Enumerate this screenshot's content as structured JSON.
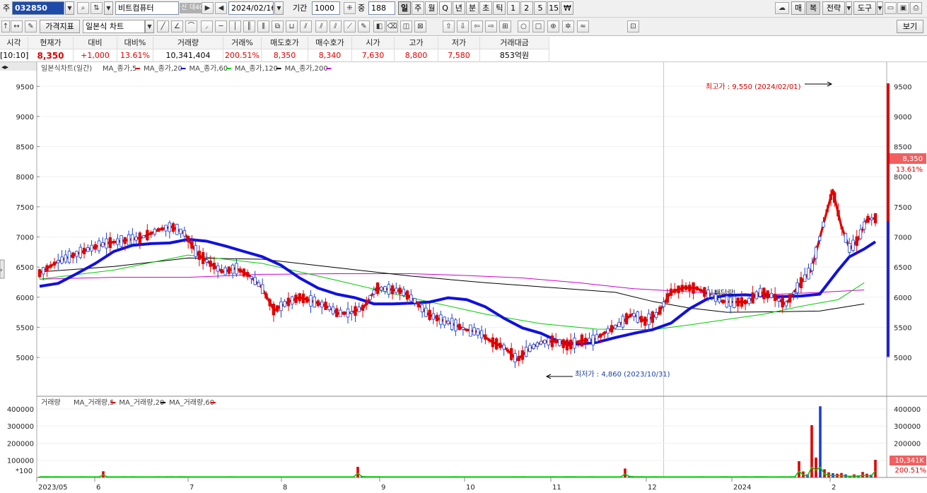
{
  "toolbar": {
    "market_prefix": "주",
    "stock_code": "032850",
    "stock_name": "비트컴퓨터",
    "credit_tag": "신",
    "margin_tag": "대40",
    "date": "2024/02/16",
    "period_label": "기간",
    "period_value": "1000",
    "count_label": "중",
    "count_value": "188",
    "periods": [
      "일",
      "주",
      "월",
      "Q",
      "년",
      "분",
      "초",
      "틱",
      "1",
      "2",
      "5",
      "15",
      "₩"
    ],
    "active_period": "일",
    "right_tabs": [
      "매",
      "복",
      "전략",
      "도구"
    ],
    "second_row": {
      "price_indicator_label": "가격지표",
      "chart_type_value": "일본식 차트",
      "view_label": "보기"
    }
  },
  "quote": {
    "headers": [
      "시각",
      "현재가",
      "대비",
      "대비%",
      "거래량",
      "거래%",
      "매도호가",
      "매수호가",
      "시가",
      "고가",
      "저가",
      "거래대금"
    ],
    "values": [
      "[10:10]",
      "8,350",
      "+1,000",
      "13.61%",
      "10,341,404",
      "200.51%",
      "8,350",
      "8,340",
      "7,630",
      "8,800",
      "7,580",
      "853억원"
    ]
  },
  "chart_data": [
    {
      "type": "candlestick",
      "legend_title": "일본식차트(일간)",
      "series": [
        {
          "name": "MA_종가,5",
          "color": "#e00000"
        },
        {
          "name": "MA_종가,20",
          "color": "#0000ee"
        },
        {
          "name": "MA_종가,60",
          "color": "#00cc00"
        },
        {
          "name": "MA_종가,120",
          "color": "#000000"
        },
        {
          "name": "MA_종가,200",
          "color": "#cc00cc"
        }
      ],
      "y_ticks": [
        9500,
        9000,
        8500,
        8000,
        7500,
        7000,
        6500,
        6000,
        5500,
        5000
      ],
      "ylim": [
        4700,
        9800
      ],
      "x_labels": [
        "2023/05",
        "6",
        "7",
        "8",
        "9",
        "10",
        "11",
        "12",
        "2024",
        "2"
      ],
      "current_price_label": "8,350",
      "current_change_label": "13.61%",
      "annotations": {
        "high": "최고가 : 9,550 (2024/02/01)",
        "low": "최저가 : 4,860 (2023/10/31)",
        "dividend": "배당락"
      },
      "ma20_path": [
        [
          0,
          6180
        ],
        [
          5,
          6230
        ],
        [
          10,
          6390
        ],
        [
          15,
          6560
        ],
        [
          20,
          6760
        ],
        [
          25,
          6860
        ],
        [
          30,
          6890
        ],
        [
          35,
          6900
        ],
        [
          40,
          6960
        ],
        [
          45,
          6930
        ],
        [
          50,
          6850
        ],
        [
          55,
          6760
        ],
        [
          60,
          6670
        ],
        [
          65,
          6530
        ],
        [
          70,
          6320
        ],
        [
          75,
          6150
        ],
        [
          80,
          6050
        ],
        [
          85,
          5990
        ],
        [
          90,
          5890
        ],
        [
          95,
          5890
        ],
        [
          100,
          5900
        ],
        [
          105,
          5920
        ],
        [
          110,
          5990
        ],
        [
          115,
          5960
        ],
        [
          120,
          5840
        ],
        [
          125,
          5650
        ],
        [
          130,
          5490
        ],
        [
          135,
          5400
        ],
        [
          140,
          5260
        ],
        [
          145,
          5220
        ],
        [
          150,
          5250
        ],
        [
          155,
          5330
        ],
        [
          160,
          5400
        ],
        [
          165,
          5460
        ],
        [
          170,
          5570
        ],
        [
          175,
          5810
        ],
        [
          180,
          5980
        ],
        [
          185,
          6030
        ],
        [
          190,
          6040
        ],
        [
          195,
          6020
        ],
        [
          200,
          6010
        ],
        [
          205,
          6020
        ],
        [
          210,
          6050
        ],
        [
          215,
          6450
        ],
        [
          218,
          6670
        ],
        [
          222,
          6800
        ],
        [
          225,
          6920
        ]
      ],
      "ma5_path": [
        [
          0,
          6400
        ],
        [
          4,
          6580
        ],
        [
          8,
          6700
        ],
        [
          12,
          6810
        ],
        [
          16,
          6900
        ],
        [
          20,
          6940
        ],
        [
          24,
          6990
        ],
        [
          28,
          7120
        ],
        [
          31,
          7170
        ],
        [
          34,
          7060
        ],
        [
          37,
          6720
        ],
        [
          40,
          6560
        ],
        [
          43,
          6420
        ],
        [
          46,
          6480
        ],
        [
          49,
          6370
        ],
        [
          52,
          6170
        ],
        [
          55,
          5780
        ],
        [
          58,
          5910
        ],
        [
          61,
          6000
        ],
        [
          64,
          5930
        ],
        [
          67,
          5860
        ],
        [
          70,
          5730
        ],
        [
          73,
          5740
        ],
        [
          76,
          5830
        ],
        [
          79,
          6150
        ],
        [
          82,
          6130
        ],
        [
          85,
          6100
        ],
        [
          88,
          5940
        ],
        [
          91,
          5720
        ],
        [
          94,
          5630
        ],
        [
          97,
          5550
        ],
        [
          100,
          5460
        ],
        [
          103,
          5420
        ],
        [
          106,
          5260
        ],
        [
          109,
          5170
        ],
        [
          112,
          4960
        ],
        [
          115,
          5150
        ],
        [
          118,
          5260
        ],
        [
          121,
          5270
        ],
        [
          124,
          5200
        ],
        [
          127,
          5280
        ],
        [
          130,
          5290
        ],
        [
          133,
          5430
        ],
        [
          136,
          5550
        ],
        [
          139,
          5720
        ],
        [
          142,
          5600
        ],
        [
          145,
          5720
        ],
        [
          148,
          6080
        ],
        [
          151,
          6160
        ],
        [
          154,
          6150
        ],
        [
          157,
          6050
        ],
        [
          160,
          5930
        ],
        [
          163,
          5920
        ],
        [
          166,
          5920
        ],
        [
          169,
          6080
        ],
        [
          172,
          6020
        ],
        [
          175,
          5880
        ],
        [
          178,
          6190
        ],
        [
          181,
          6450
        ],
        [
          184,
          7260
        ],
        [
          186,
          7780
        ],
        [
          188,
          7180
        ],
        [
          190,
          6800
        ],
        [
          192,
          6960
        ],
        [
          194,
          7290
        ],
        [
          196,
          7310
        ]
      ],
      "ma60_path": [
        [
          0,
          6300
        ],
        [
          20,
          6450
        ],
        [
          40,
          6700
        ],
        [
          60,
          6560
        ],
        [
          80,
          6280
        ],
        [
          100,
          5990
        ],
        [
          120,
          5720
        ],
        [
          135,
          5560
        ],
        [
          150,
          5470
        ],
        [
          165,
          5460
        ],
        [
          175,
          5540
        ],
        [
          185,
          5630
        ],
        [
          195,
          5720
        ],
        [
          205,
          5850
        ],
        [
          215,
          5960
        ],
        [
          222,
          6240
        ]
      ],
      "ma120_path": [
        [
          0,
          6420
        ],
        [
          20,
          6510
        ],
        [
          40,
          6650
        ],
        [
          60,
          6630
        ],
        [
          80,
          6490
        ],
        [
          100,
          6350
        ],
        [
          120,
          6240
        ],
        [
          140,
          6150
        ],
        [
          155,
          6080
        ],
        [
          165,
          5930
        ],
        [
          175,
          5820
        ],
        [
          185,
          5750
        ],
        [
          200,
          5760
        ],
        [
          210,
          5770
        ],
        [
          222,
          5890
        ]
      ],
      "ma200_path": [
        [
          0,
          6300
        ],
        [
          20,
          6330
        ],
        [
          40,
          6330
        ],
        [
          60,
          6380
        ],
        [
          80,
          6390
        ],
        [
          100,
          6390
        ],
        [
          115,
          6360
        ],
        [
          130,
          6320
        ],
        [
          145,
          6240
        ],
        [
          160,
          6140
        ],
        [
          175,
          6090
        ],
        [
          185,
          6050
        ],
        [
          195,
          6040
        ],
        [
          210,
          6080
        ],
        [
          222,
          6120
        ]
      ]
    },
    {
      "type": "bar",
      "legend_title": "거래량",
      "series": [
        {
          "name": "MA_거래량,5",
          "color": "#e00000"
        },
        {
          "name": "MA_거래량,20",
          "color": "#000000"
        },
        {
          "name": "MA_거래량,60",
          "color": "#e00000"
        }
      ],
      "y_ticks": [
        400000,
        300000,
        200000,
        100000
      ],
      "ylim": [
        0,
        420000
      ],
      "unit_label": "*100",
      "current_volume_label": "10,341K",
      "current_ratio_label": "200.51%",
      "values": [
        4000,
        3000,
        3500,
        2500,
        3000,
        2000,
        2800,
        2600,
        2400,
        2200,
        3000,
        2500,
        2700,
        2300,
        2100,
        36000,
        2200,
        2000,
        1800,
        2500,
        3000,
        2600,
        3100,
        2000,
        2400,
        2200,
        2800,
        2000,
        3300,
        2500,
        2900,
        3200,
        2200,
        3500,
        3000,
        2600,
        2100,
        2000,
        2700,
        2400,
        2200,
        1900,
        2800,
        2600,
        2400,
        3100,
        2000,
        2200,
        2500,
        2800,
        1900,
        2100,
        2600,
        2300,
        2500,
        2700,
        2000,
        2200,
        2400,
        2100,
        2600,
        2300,
        2500,
        1900,
        2100,
        2400,
        2800,
        2200,
        2000,
        2500,
        2300,
        2600,
        2200,
        2700,
        2400,
        62000,
        8000,
        4000,
        3000,
        3600,
        3000,
        2500,
        2200,
        2000,
        2600,
        2300,
        2100,
        2800,
        2500,
        2000,
        2200,
        2400,
        2600,
        2300,
        2500,
        2200,
        2000,
        2800,
        3000,
        2700,
        2500,
        2300,
        2100,
        2600,
        2400,
        2200,
        2600,
        2300,
        2800,
        2500,
        2100,
        2300,
        2900,
        2600,
        3500,
        2200,
        2500,
        2400,
        2200,
        2300,
        2600,
        3000,
        2800,
        2700,
        3000,
        3200,
        2900,
        2500,
        2400,
        2200,
        3000,
        2600,
        2800,
        2500,
        2400,
        2600,
        2700,
        2200,
        52000,
        9000,
        6000,
        4500,
        3000,
        2800,
        2600,
        3000,
        2200,
        2500,
        2400,
        2600,
        2300,
        2500,
        2200,
        2000,
        2800,
        2600,
        3000,
        2400,
        2200,
        2500,
        2600,
        2900,
        3100,
        2800,
        2600,
        2500,
        3000,
        2800,
        2600,
        3300,
        3000,
        2900,
        2500,
        2300,
        2200,
        2900,
        2600,
        3000,
        3200,
        95000,
        35000,
        18000,
        305000,
        116000,
        415000,
        48000,
        30000,
        25000,
        22000,
        26000,
        18000,
        10000,
        18000,
        12000,
        32000,
        22000,
        16000,
        103000
      ]
    }
  ]
}
